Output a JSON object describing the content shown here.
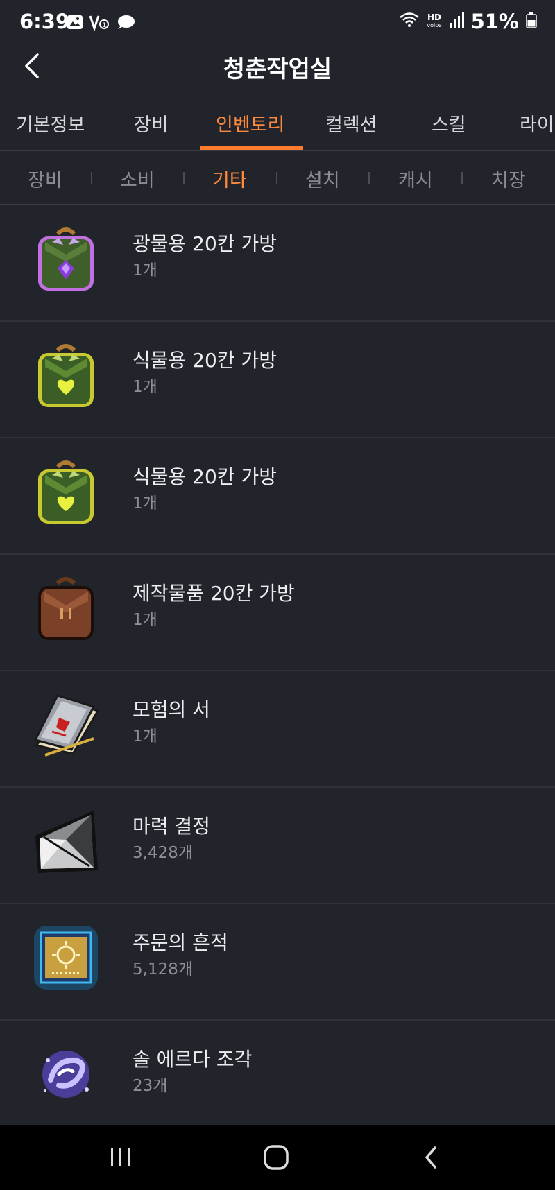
{
  "status": {
    "time": "6:39",
    "battery": "51%",
    "hd_label": "HD",
    "voice_label": "voice"
  },
  "header": {
    "title": "청춘작업실"
  },
  "tabs": [
    {
      "label": "기본정보"
    },
    {
      "label": "장비"
    },
    {
      "label": "인벤토리",
      "active": true
    },
    {
      "label": "컬렉션"
    },
    {
      "label": "스킬"
    },
    {
      "label": "라이"
    }
  ],
  "subtabs": [
    {
      "label": "장비"
    },
    {
      "label": "소비"
    },
    {
      "label": "기타",
      "active": true
    },
    {
      "label": "설치"
    },
    {
      "label": "캐시"
    },
    {
      "label": "치장"
    }
  ],
  "items": [
    {
      "name": "광물용 20칸 가방",
      "qty": "1개",
      "icon": "mineral-bag-icon"
    },
    {
      "name": "식물용 20칸 가방",
      "qty": "1개",
      "icon": "herb-bag-icon"
    },
    {
      "name": "식물용 20칸 가방",
      "qty": "1개",
      "icon": "herb-bag-icon"
    },
    {
      "name": "제작물품 20칸 가방",
      "qty": "1개",
      "icon": "crafting-bag-icon"
    },
    {
      "name": "모험의 서",
      "qty": "1개",
      "icon": "adventure-book-icon"
    },
    {
      "name": "마력 결정",
      "qty": "3,428개",
      "icon": "magic-crystal-icon"
    },
    {
      "name": "주문의 흔적",
      "qty": "5,128개",
      "icon": "spell-trace-icon"
    },
    {
      "name": "솔 에르다 조각",
      "qty": "23개",
      "icon": "sol-erda-fragment-icon"
    }
  ],
  "colors": {
    "accent": "#ff8a3d",
    "background": "#22242c"
  }
}
